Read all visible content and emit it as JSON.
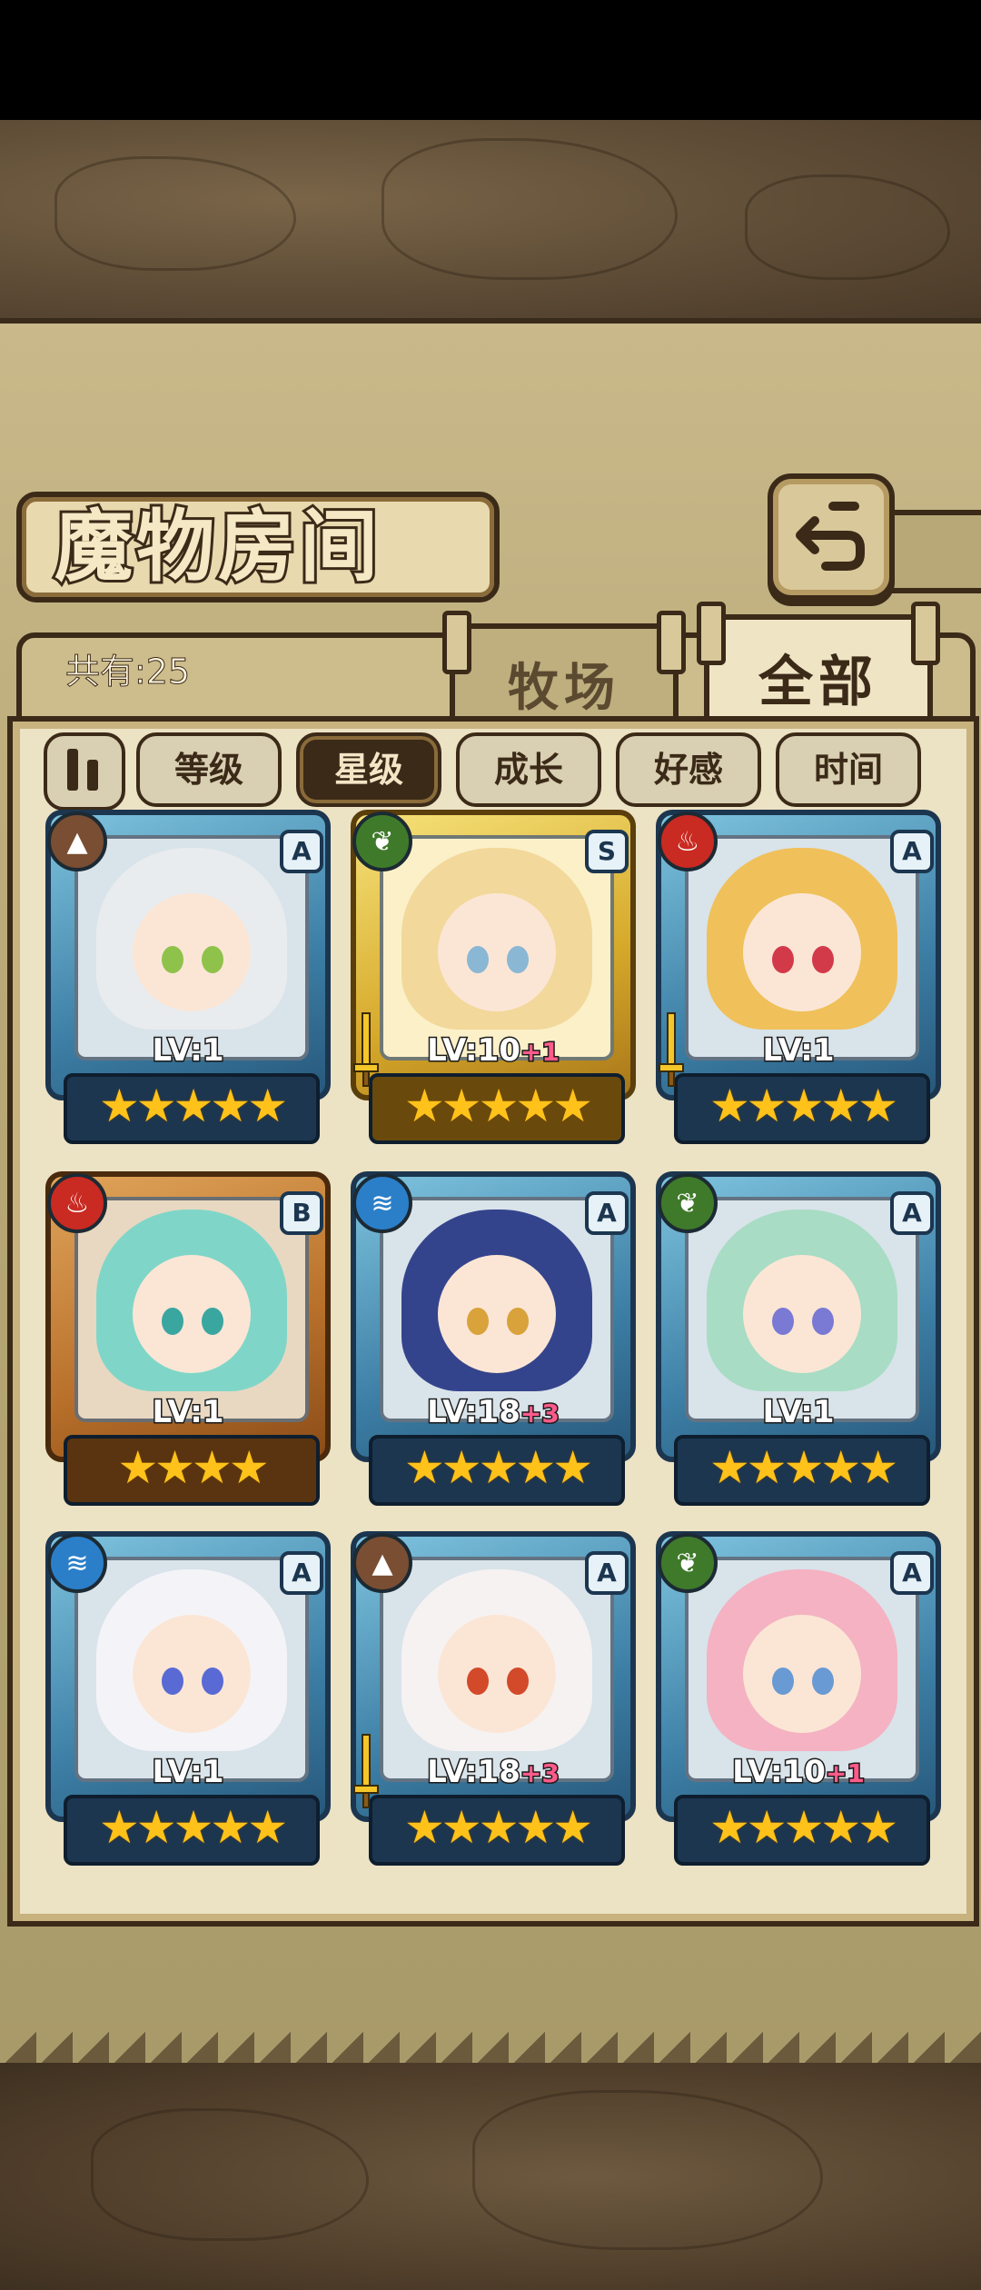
{
  "title": "魔物房间",
  "header": {
    "back_icon": "return-arrow-icon"
  },
  "info": {
    "count_label": "共有:25"
  },
  "tabs": [
    {
      "label": "牧场",
      "active": false
    },
    {
      "label": "全部",
      "active": true
    }
  ],
  "sort": {
    "toggle_icon": "sort-order-icon",
    "buttons": [
      {
        "label": "等级",
        "active": false
      },
      {
        "label": "星级",
        "active": true
      },
      {
        "label": "成长",
        "active": false
      },
      {
        "label": "好感",
        "active": false
      },
      {
        "label": "时间",
        "active": false
      }
    ]
  },
  "cards": [
    {
      "element": "earth",
      "element_glyph": "▲",
      "rank": "A",
      "level": "LV:1",
      "bonus": "",
      "stars": 5,
      "equipped_weapon": false,
      "hair": "#e8ecef",
      "eyes": "#8fc24a"
    },
    {
      "element": "wood",
      "element_glyph": "❦",
      "rank": "S",
      "level": "LV:10",
      "bonus": "+1",
      "stars": 5,
      "equipped_weapon": true,
      "hair": "#f2d89a",
      "eyes": "#8ab7d4"
    },
    {
      "element": "fire",
      "element_glyph": "♨",
      "rank": "A",
      "level": "LV:1",
      "bonus": "",
      "stars": 5,
      "equipped_weapon": true,
      "hair": "#f0c05a",
      "eyes": "#d23a4a"
    },
    {
      "element": "fire",
      "element_glyph": "♨",
      "rank": "B",
      "level": "LV:1",
      "bonus": "",
      "stars": 4,
      "equipped_weapon": false,
      "hair": "#7fd6c8",
      "eyes": "#3aa6a0"
    },
    {
      "element": "water",
      "element_glyph": "≋",
      "rank": "A",
      "level": "LV:18",
      "bonus": "+3",
      "stars": 5,
      "equipped_weapon": false,
      "hair": "#34448c",
      "eyes": "#d9a23a"
    },
    {
      "element": "wood",
      "element_glyph": "❦",
      "rank": "A",
      "level": "LV:1",
      "bonus": "",
      "stars": 5,
      "equipped_weapon": false,
      "hair": "#a8dcc4",
      "eyes": "#7a7ad4"
    },
    {
      "element": "water",
      "element_glyph": "≋",
      "rank": "A",
      "level": "LV:1",
      "bonus": "",
      "stars": 5,
      "equipped_weapon": false,
      "hair": "#f4f4f8",
      "eyes": "#5a6ad4"
    },
    {
      "element": "earth",
      "element_glyph": "▲",
      "rank": "A",
      "level": "LV:18",
      "bonus": "+3",
      "stars": 5,
      "equipped_weapon": true,
      "hair": "#f6f2f2",
      "eyes": "#d24a2a"
    },
    {
      "element": "wood",
      "element_glyph": "❦",
      "rank": "A",
      "level": "LV:10",
      "bonus": "+1",
      "stars": 5,
      "equipped_weapon": false,
      "hair": "#f4b2c2",
      "eyes": "#6a9ad4"
    }
  ]
}
